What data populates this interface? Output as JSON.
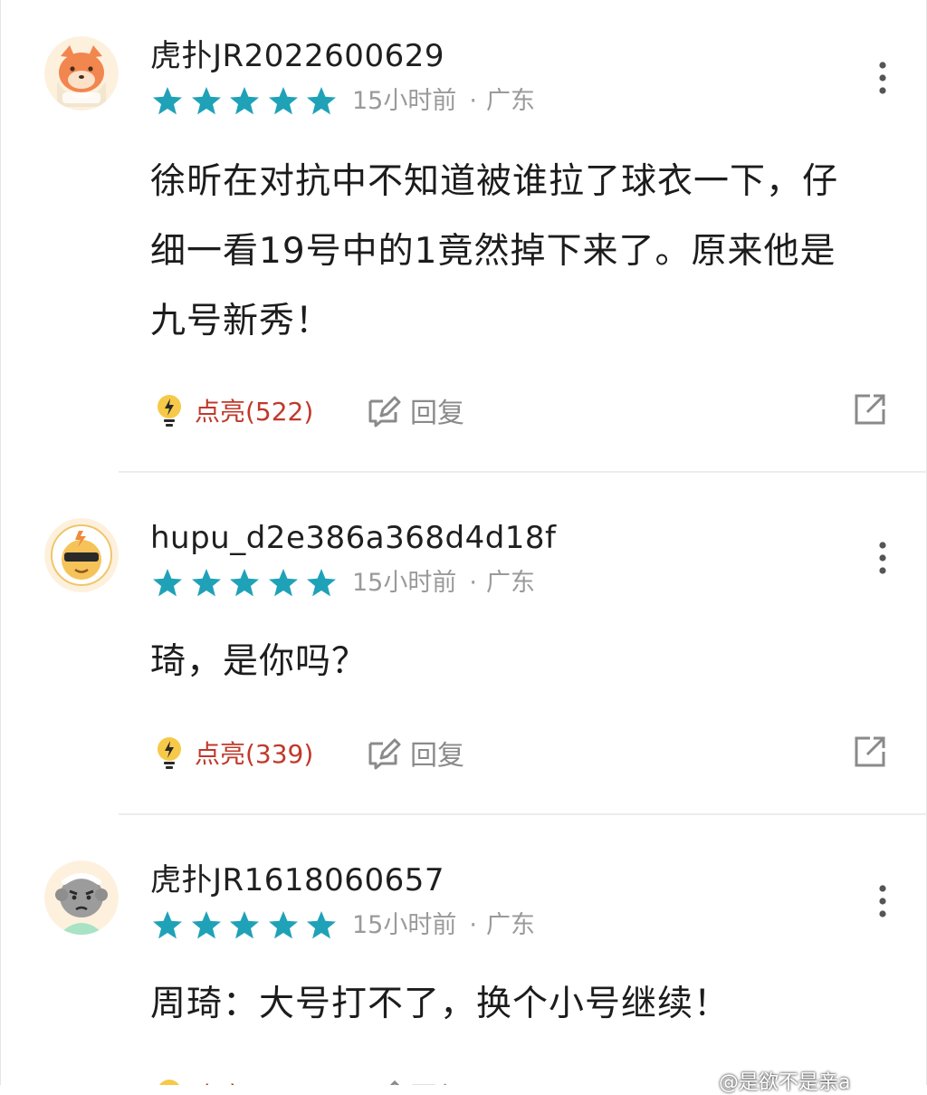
{
  "colors": {
    "star": "#1fa2b8",
    "light_text": "#c0392b",
    "meta_text": "#9a9a9a",
    "divider": "#ececec"
  },
  "comments": [
    {
      "username": "虎扑JR2022600629",
      "rating": 5,
      "time": "15小时前",
      "location": "广东",
      "text_lines": [
        "徐昕在对抗中不知道被谁拉了球衣一下，仔",
        "细一看19号中的1竟然掉下来了。原来他是",
        "九号新秀！"
      ],
      "light_label": "点亮(522)",
      "reply_label": "回复",
      "avatar_icon": "fox-avatar-icon"
    },
    {
      "username": "hupu_d2e386a368d4d18f",
      "rating": 5,
      "time": "15小时前",
      "location": "广东",
      "text_lines": [
        "琦，是你吗？"
      ],
      "light_label": "点亮(339)",
      "reply_label": "回复",
      "avatar_icon": "sunglasses-avatar-icon"
    },
    {
      "username": "虎扑JR1618060657",
      "rating": 5,
      "time": "15小时前",
      "location": "广东",
      "text_lines": [
        "周琦：大号打不了，换个小号继续！"
      ],
      "light_label": "点亮",
      "reply_label": "回复",
      "avatar_icon": "grumpy-avatar-icon"
    }
  ],
  "separator_dot": "·",
  "watermark": "@是欲不是亲a"
}
